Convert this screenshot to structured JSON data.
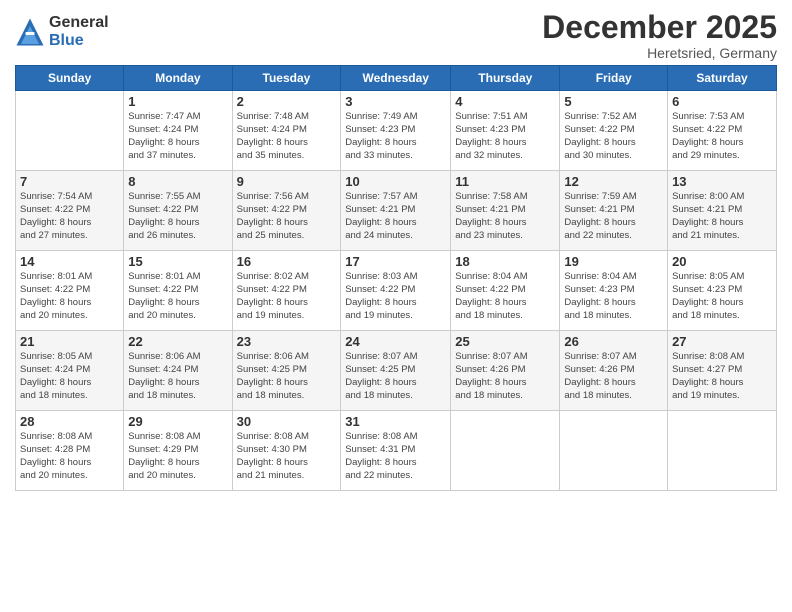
{
  "header": {
    "logo_general": "General",
    "logo_blue": "Blue",
    "month_title": "December 2025",
    "location": "Heretsried, Germany"
  },
  "weekdays": [
    "Sunday",
    "Monday",
    "Tuesday",
    "Wednesday",
    "Thursday",
    "Friday",
    "Saturday"
  ],
  "weeks": [
    [
      {
        "day": "",
        "info": ""
      },
      {
        "day": "1",
        "info": "Sunrise: 7:47 AM\nSunset: 4:24 PM\nDaylight: 8 hours\nand 37 minutes."
      },
      {
        "day": "2",
        "info": "Sunrise: 7:48 AM\nSunset: 4:24 PM\nDaylight: 8 hours\nand 35 minutes."
      },
      {
        "day": "3",
        "info": "Sunrise: 7:49 AM\nSunset: 4:23 PM\nDaylight: 8 hours\nand 33 minutes."
      },
      {
        "day": "4",
        "info": "Sunrise: 7:51 AM\nSunset: 4:23 PM\nDaylight: 8 hours\nand 32 minutes."
      },
      {
        "day": "5",
        "info": "Sunrise: 7:52 AM\nSunset: 4:22 PM\nDaylight: 8 hours\nand 30 minutes."
      },
      {
        "day": "6",
        "info": "Sunrise: 7:53 AM\nSunset: 4:22 PM\nDaylight: 8 hours\nand 29 minutes."
      }
    ],
    [
      {
        "day": "7",
        "info": "Sunrise: 7:54 AM\nSunset: 4:22 PM\nDaylight: 8 hours\nand 27 minutes."
      },
      {
        "day": "8",
        "info": "Sunrise: 7:55 AM\nSunset: 4:22 PM\nDaylight: 8 hours\nand 26 minutes."
      },
      {
        "day": "9",
        "info": "Sunrise: 7:56 AM\nSunset: 4:22 PM\nDaylight: 8 hours\nand 25 minutes."
      },
      {
        "day": "10",
        "info": "Sunrise: 7:57 AM\nSunset: 4:21 PM\nDaylight: 8 hours\nand 24 minutes."
      },
      {
        "day": "11",
        "info": "Sunrise: 7:58 AM\nSunset: 4:21 PM\nDaylight: 8 hours\nand 23 minutes."
      },
      {
        "day": "12",
        "info": "Sunrise: 7:59 AM\nSunset: 4:21 PM\nDaylight: 8 hours\nand 22 minutes."
      },
      {
        "day": "13",
        "info": "Sunrise: 8:00 AM\nSunset: 4:21 PM\nDaylight: 8 hours\nand 21 minutes."
      }
    ],
    [
      {
        "day": "14",
        "info": "Sunrise: 8:01 AM\nSunset: 4:22 PM\nDaylight: 8 hours\nand 20 minutes."
      },
      {
        "day": "15",
        "info": "Sunrise: 8:01 AM\nSunset: 4:22 PM\nDaylight: 8 hours\nand 20 minutes."
      },
      {
        "day": "16",
        "info": "Sunrise: 8:02 AM\nSunset: 4:22 PM\nDaylight: 8 hours\nand 19 minutes."
      },
      {
        "day": "17",
        "info": "Sunrise: 8:03 AM\nSunset: 4:22 PM\nDaylight: 8 hours\nand 19 minutes."
      },
      {
        "day": "18",
        "info": "Sunrise: 8:04 AM\nSunset: 4:22 PM\nDaylight: 8 hours\nand 18 minutes."
      },
      {
        "day": "19",
        "info": "Sunrise: 8:04 AM\nSunset: 4:23 PM\nDaylight: 8 hours\nand 18 minutes."
      },
      {
        "day": "20",
        "info": "Sunrise: 8:05 AM\nSunset: 4:23 PM\nDaylight: 8 hours\nand 18 minutes."
      }
    ],
    [
      {
        "day": "21",
        "info": "Sunrise: 8:05 AM\nSunset: 4:24 PM\nDaylight: 8 hours\nand 18 minutes."
      },
      {
        "day": "22",
        "info": "Sunrise: 8:06 AM\nSunset: 4:24 PM\nDaylight: 8 hours\nand 18 minutes."
      },
      {
        "day": "23",
        "info": "Sunrise: 8:06 AM\nSunset: 4:25 PM\nDaylight: 8 hours\nand 18 minutes."
      },
      {
        "day": "24",
        "info": "Sunrise: 8:07 AM\nSunset: 4:25 PM\nDaylight: 8 hours\nand 18 minutes."
      },
      {
        "day": "25",
        "info": "Sunrise: 8:07 AM\nSunset: 4:26 PM\nDaylight: 8 hours\nand 18 minutes."
      },
      {
        "day": "26",
        "info": "Sunrise: 8:07 AM\nSunset: 4:26 PM\nDaylight: 8 hours\nand 18 minutes."
      },
      {
        "day": "27",
        "info": "Sunrise: 8:08 AM\nSunset: 4:27 PM\nDaylight: 8 hours\nand 19 minutes."
      }
    ],
    [
      {
        "day": "28",
        "info": "Sunrise: 8:08 AM\nSunset: 4:28 PM\nDaylight: 8 hours\nand 20 minutes."
      },
      {
        "day": "29",
        "info": "Sunrise: 8:08 AM\nSunset: 4:29 PM\nDaylight: 8 hours\nand 20 minutes."
      },
      {
        "day": "30",
        "info": "Sunrise: 8:08 AM\nSunset: 4:30 PM\nDaylight: 8 hours\nand 21 minutes."
      },
      {
        "day": "31",
        "info": "Sunrise: 8:08 AM\nSunset: 4:31 PM\nDaylight: 8 hours\nand 22 minutes."
      },
      {
        "day": "",
        "info": ""
      },
      {
        "day": "",
        "info": ""
      },
      {
        "day": "",
        "info": ""
      }
    ]
  ]
}
